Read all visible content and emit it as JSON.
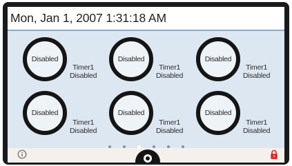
{
  "header": {
    "datetime": "Mon, Jan 1, 2007 1:31:18 AM"
  },
  "tiles": [
    {
      "status": "Disabled",
      "name": "Timer1",
      "state": "Disabled"
    },
    {
      "status": "Disabled",
      "name": "Timer1",
      "state": "Disabled"
    },
    {
      "status": "Disabled",
      "name": "Timer1",
      "state": "Disabled"
    },
    {
      "status": "Disabled",
      "name": "Timer1",
      "state": "Disabled"
    },
    {
      "status": "Disabled",
      "name": "Timer1",
      "state": "Disabled"
    },
    {
      "status": "Disabled",
      "name": "Timer1",
      "state": "Disabled"
    }
  ],
  "pager": {
    "page_count": 6,
    "active_page": 3
  },
  "footer": {
    "icons": [
      "info-icon",
      "home-button-icon",
      "lock-icon"
    ]
  },
  "colors": {
    "bezel": "#181a1f",
    "content_background": "#dde7f2",
    "ring": "#151515",
    "lock": "#e0262b",
    "page_dot": "#7a93b5",
    "page_dot_active": "#ffffff"
  }
}
